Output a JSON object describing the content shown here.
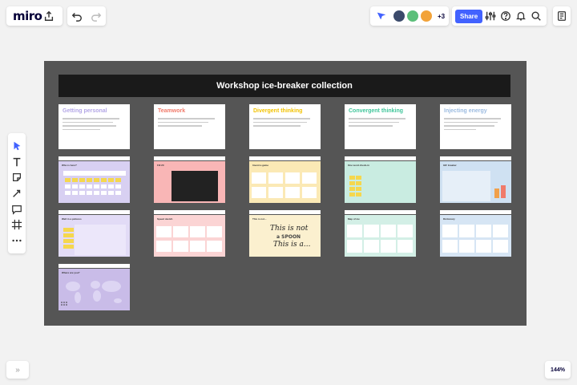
{
  "app": {
    "logo": "miro",
    "zoom": "144%",
    "share_label": "Share",
    "more_collaborators": "+3",
    "collapse_label": "»"
  },
  "board": {
    "title": "Workshop ice-breaker collection",
    "categories": [
      {
        "title": "Getting personal",
        "color": "#b3a6e6"
      },
      {
        "title": "Teamwork",
        "color": "#f07a6a"
      },
      {
        "title": "Divergent thinking",
        "color": "#f2c200"
      },
      {
        "title": "Convergent thinking",
        "color": "#3fc59a"
      },
      {
        "title": "Injecting energy",
        "color": "#9bbbe0"
      }
    ],
    "templates": [
      {
        "title": "Who is here?",
        "bg": "#d8d0f2"
      },
      {
        "title": "Fill 20",
        "bg": "#f9b6b6"
      },
      {
        "title": "Invent a game",
        "bg": "#fbe9b5"
      },
      {
        "title": "One word check-in",
        "bg": "#c9ece1"
      },
      {
        "title": "GIF breaker",
        "bg": "#cfe1f2"
      },
      {
        "title": "Well in a pictures",
        "bg": "#e2dbf6"
      },
      {
        "title": "Speed sketch",
        "bg": "#fbd4d4"
      },
      {
        "title": "This is not...",
        "bg": "#fbf0cf"
      },
      {
        "title": "Map of me",
        "bg": "#d3efe6"
      },
      {
        "title": "Dictionary",
        "bg": "#d6e5f4"
      },
      {
        "title": "Where are you?",
        "bg": "#c9bce8"
      }
    ],
    "this_is_not_text": [
      "This is not",
      "a SPOON",
      "This is a..."
    ]
  },
  "colors": {
    "accent": "#4262ff",
    "board_bg": "#555555",
    "sticky": "#f5d74d"
  }
}
